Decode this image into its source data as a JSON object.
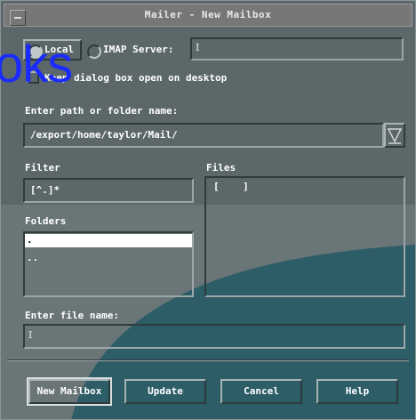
{
  "window": {
    "title": "Mailer - New Mailbox"
  },
  "source": {
    "local_label": "Local",
    "imap_label": "IMAP Server:",
    "imap_value": ""
  },
  "options": {
    "keep_open_label": "Keep dialog box open on desktop"
  },
  "overlay": {
    "text": "oks"
  },
  "path": {
    "label": "Enter path or folder name:",
    "value": "/export/home/taylor/Mail/"
  },
  "filter": {
    "label": "Filter",
    "value": "[^.]*"
  },
  "files": {
    "label": "Files",
    "items": [
      "[    ]"
    ]
  },
  "folders": {
    "label": "Folders",
    "items": [
      ".",
      ".."
    ]
  },
  "filename": {
    "label": "Enter file name:",
    "value": ""
  },
  "buttons": {
    "new_mailbox": "New Mailbox",
    "update": "Update",
    "cancel": "Cancel",
    "help": "Help"
  },
  "colors": {
    "panel": "#4f5b5d",
    "panel_light": "#5e6a6c",
    "desktop_teal": "#2d5d67",
    "accent_blue": "#1a2bff",
    "titlebar": "#777777"
  }
}
